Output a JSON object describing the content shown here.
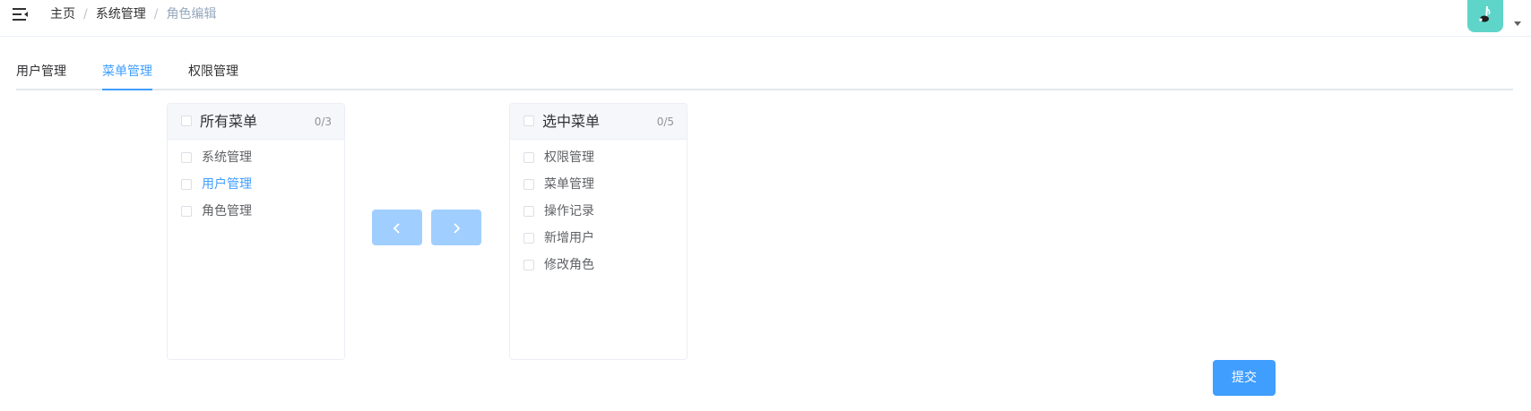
{
  "breadcrumb": [
    "主页",
    "系统管理",
    "角色编辑"
  ],
  "breadcrumb_separator": "/",
  "tabs": [
    {
      "label": "用户管理",
      "active": false
    },
    {
      "label": "菜单管理",
      "active": true
    },
    {
      "label": "权限管理",
      "active": false
    }
  ],
  "left_panel": {
    "title": "所有菜单",
    "count": "0/3",
    "items": [
      "系统管理",
      "用户管理",
      "角色管理"
    ],
    "highlighted_item": "用户管理"
  },
  "right_panel": {
    "title": "选中菜单",
    "count": "0/5",
    "items": [
      "权限管理",
      "菜单管理",
      "操作记录",
      "新增用户",
      "修改角色"
    ]
  },
  "transfer_buttons": {
    "left_icon": "chevron-left-icon",
    "right_icon": "chevron-right-icon"
  },
  "submit_label": "提交",
  "icons": {
    "menu": "menu-fold-icon",
    "avatar": "user-avatar",
    "dropdown": "caret-down-icon"
  },
  "colors": {
    "accent": "#409eff",
    "disabled_button": "#a0cfff",
    "avatar_bg": "#5fd5c9",
    "muted": "#97a8be"
  }
}
